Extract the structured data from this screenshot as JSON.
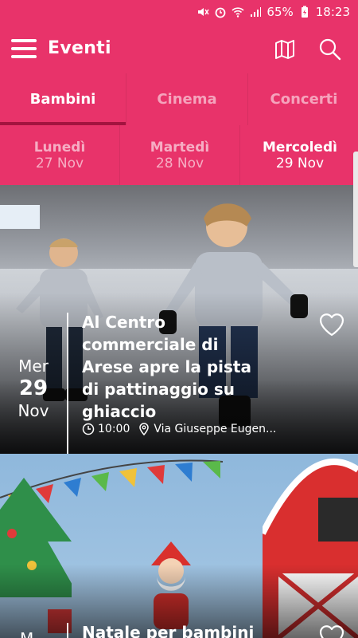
{
  "status_bar": {
    "battery": "65%",
    "time": "18:23"
  },
  "app_bar": {
    "title": "Eventi",
    "menu_icon": "hamburger-icon",
    "map_icon": "map-icon",
    "search_icon": "search-icon"
  },
  "tabs": [
    {
      "label": "Bambini",
      "active": true
    },
    {
      "label": "Cinema",
      "active": false
    },
    {
      "label": "Concerti",
      "active": false
    }
  ],
  "days": [
    {
      "name": "Lunedì",
      "date": "27 Nov",
      "active": false
    },
    {
      "name": "Martedì",
      "date": "28 Nov",
      "active": false
    },
    {
      "name": "Mercoledì",
      "date": "29 Nov",
      "active": true
    }
  ],
  "events": [
    {
      "dow": "Mer",
      "day": "29",
      "month": "Nov",
      "title": "Al Centro commerciale di Arese apre la pista di pattinaggio su ghiaccio",
      "time": "10:00",
      "location": "Via Giuseppe Eugen...",
      "favorite_icon": "heart-outline-icon"
    },
    {
      "dow": "M",
      "title": "Natale per bambini",
      "favorite_icon": "heart-outline-icon"
    }
  ],
  "colors": {
    "primary": "#e8336a",
    "tab_indicator": "#a3133f"
  }
}
